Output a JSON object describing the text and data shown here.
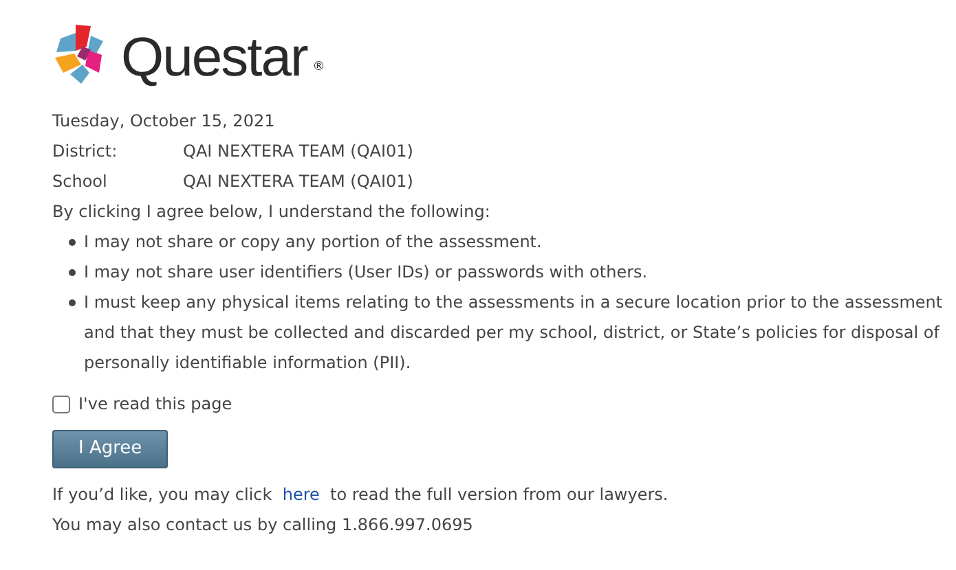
{
  "logo": {
    "wordmark": "Questar",
    "registered": "®"
  },
  "date": "Tuesday, October 15, 2021",
  "fields": [
    {
      "label": "District:",
      "value": "QAI NEXTERA TEAM (QAI01)"
    },
    {
      "label": "School",
      "value": "QAI NEXTERA TEAM (QAI01)"
    }
  ],
  "intro": "By clicking I agree below, I understand the following:",
  "bullets": [
    "I may not share or copy any portion of the assessment.",
    "I may not share user identifiers (User IDs) or passwords with others.",
    "I must keep any physical items relating to the assessments in a secure location prior to the assessment and that they must be collected and discarded per my school, district, or State’s policies for disposal of personally identifiable information (PII)."
  ],
  "checkbox": {
    "label": "I've read this page",
    "checked": false
  },
  "agree_button": {
    "label": "I Agree"
  },
  "link_line": {
    "before": "If you’d like, you may click",
    "link": "here",
    "after": "to read the full version from our lawyers."
  },
  "contact": "You may also contact us by calling 1.866.997.0695"
}
